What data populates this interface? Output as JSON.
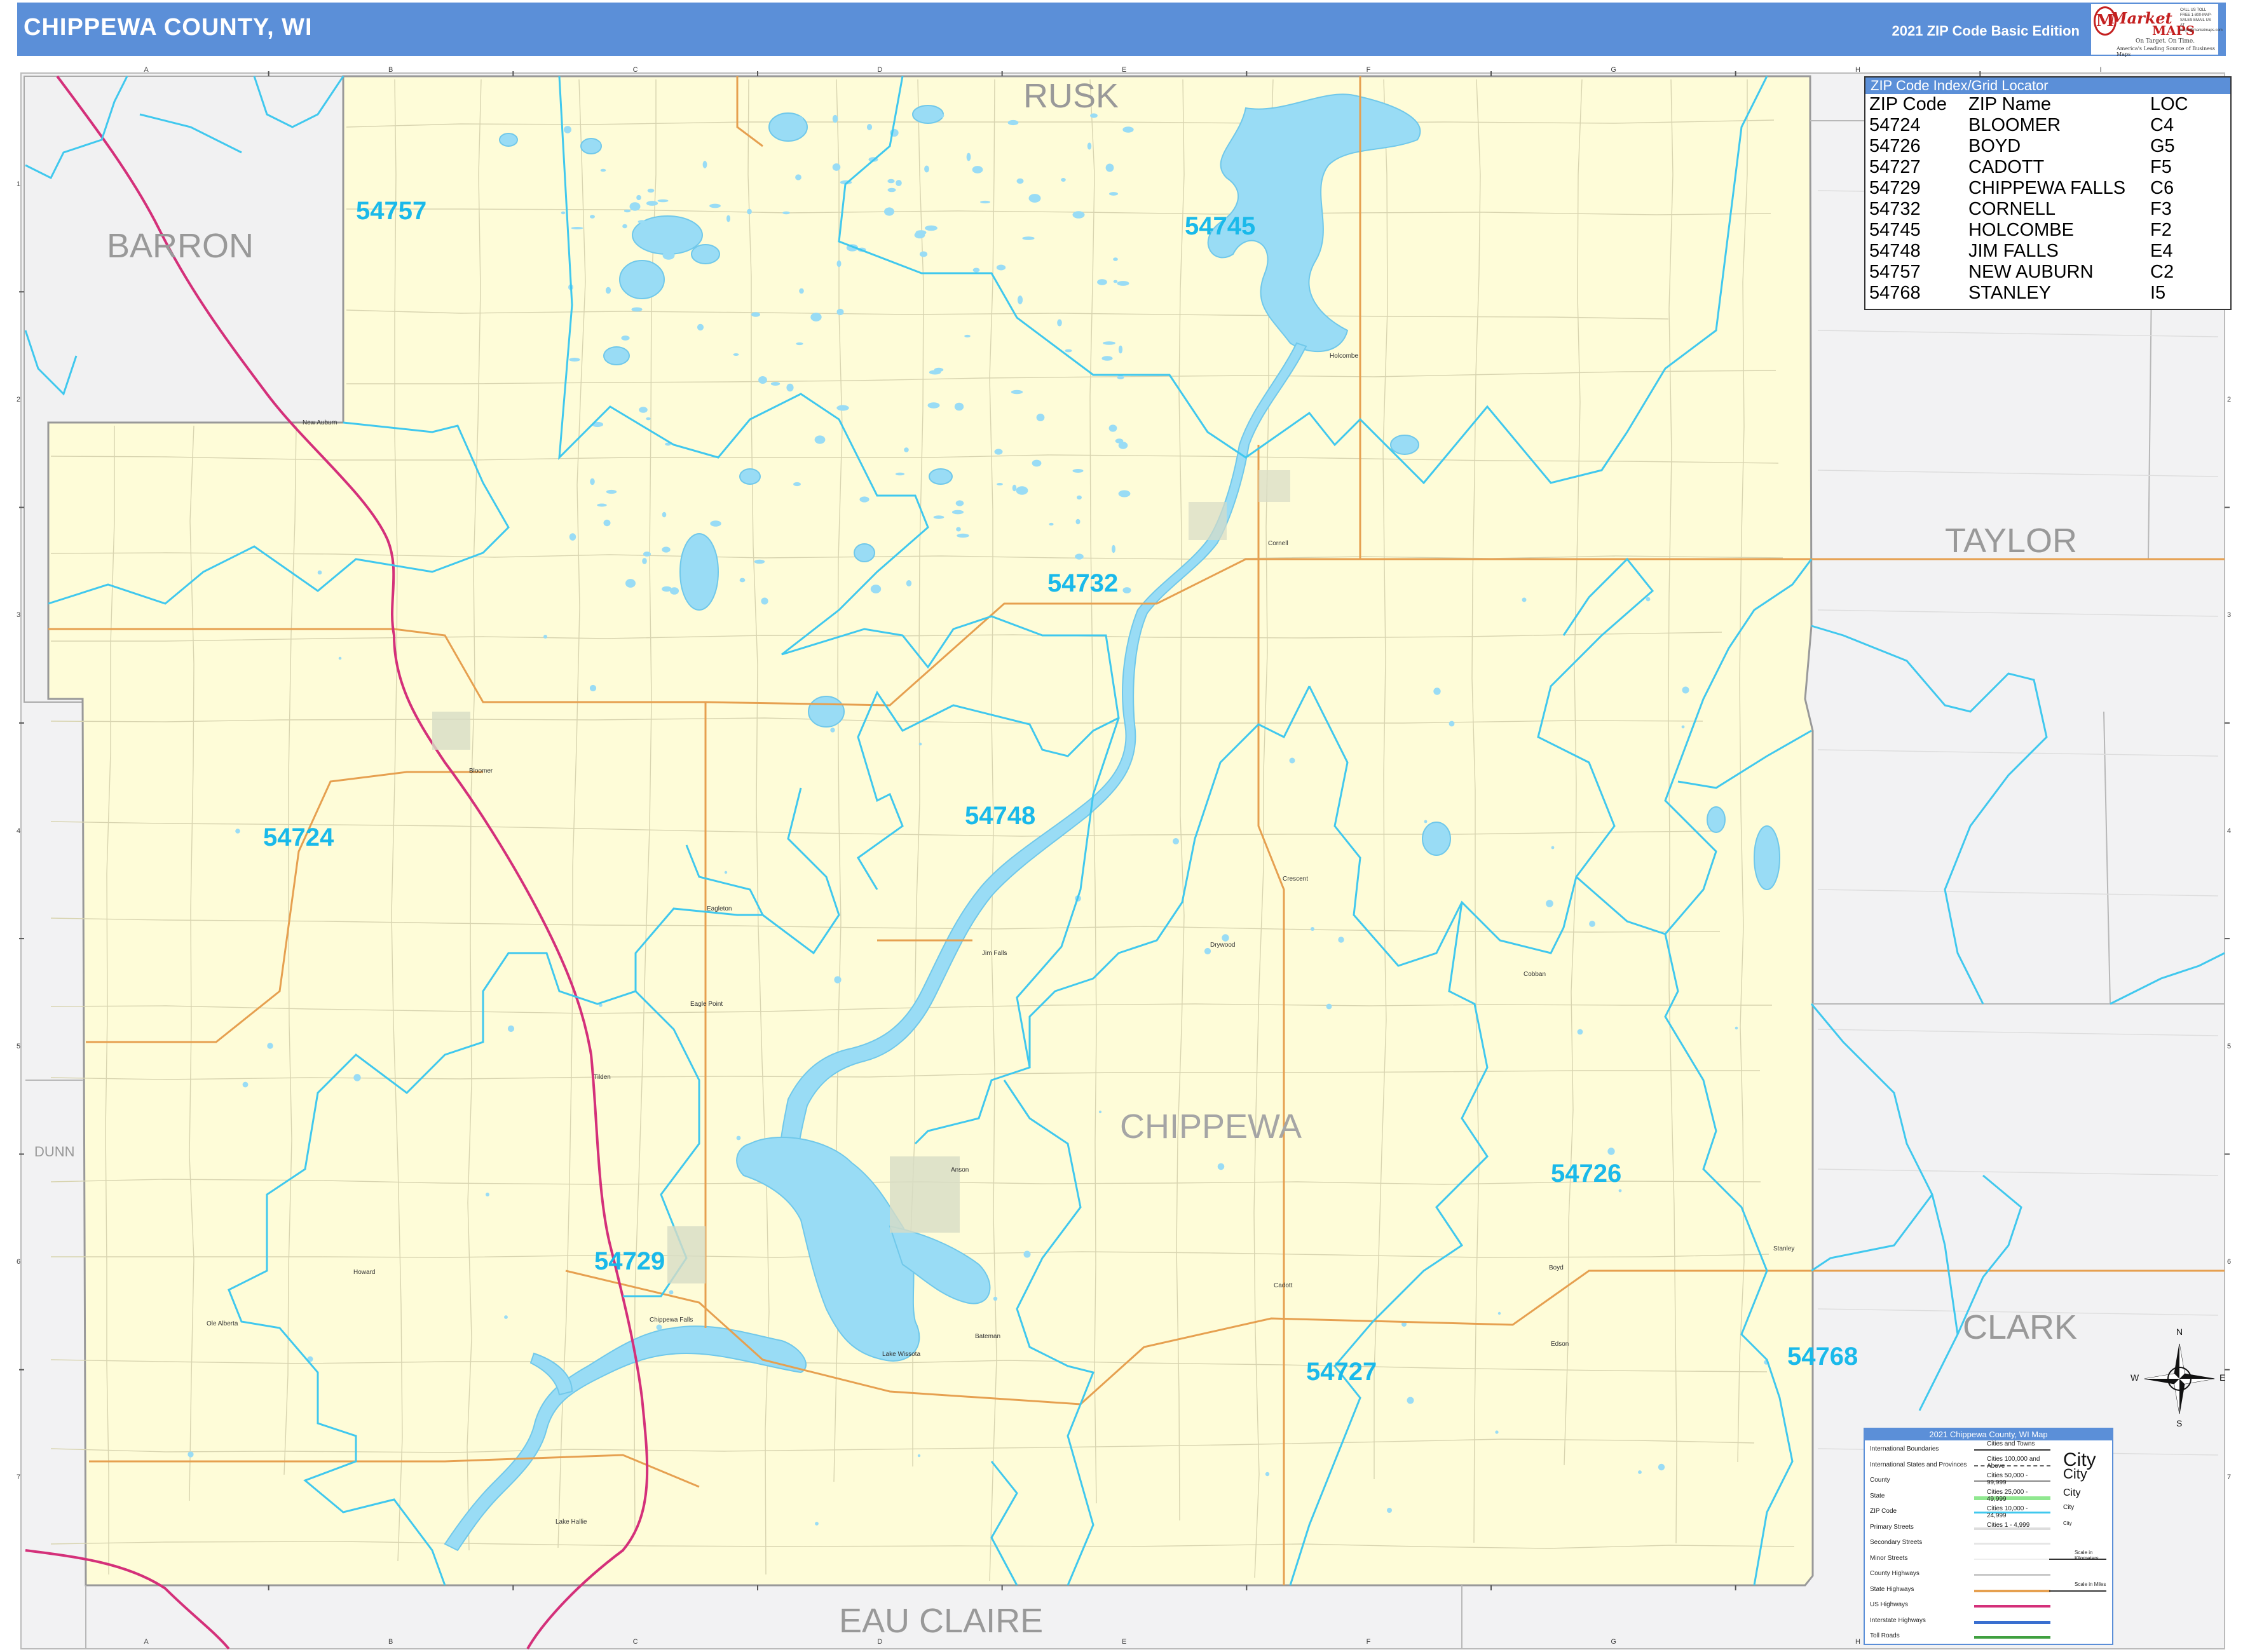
{
  "header": {
    "title": "CHIPPEWA COUNTY, WI",
    "edition": "2021 ZIP Code Basic Edition"
  },
  "logo": {
    "market": "Market",
    "maps": "MAPS",
    "tagline": "On Target. On Time.",
    "tagline2": "America's Leading Source of Business Maps",
    "call": "CALL US TOLL FREE 1-800-MAP-SALES EMAIL US AT maps@marketmaps.com"
  },
  "grid": {
    "columns": [
      "A",
      "B",
      "C",
      "D",
      "E",
      "F",
      "G",
      "H",
      "I"
    ],
    "rows": [
      "1",
      "2",
      "3",
      "4",
      "5",
      "6",
      "7"
    ]
  },
  "regions": {
    "neighbors": [
      "RUSK",
      "BARRON",
      "TAYLOR",
      "CLARK",
      "DUNN",
      "EAU CLAIRE"
    ],
    "county": "CHIPPEWA"
  },
  "zip_labels": [
    "54757",
    "54745",
    "54732",
    "54748",
    "54724",
    "54729",
    "54726",
    "54727",
    "54768"
  ],
  "places": [
    "New Auburn",
    "Holcombe",
    "Cornell",
    "Bloomer",
    "Jim Falls",
    "Eagleton",
    "Eagle Point",
    "Tilden",
    "Crescent",
    "Drywood",
    "Cobban",
    "Anson",
    "Howard",
    "Ole Alberta",
    "Chippewa Falls",
    "Lake Hallie",
    "Lake Wissota",
    "Bateman",
    "Cadott",
    "Boyd",
    "Edson",
    "Stanley"
  ],
  "zip_index": {
    "title": "ZIP Code Index/Grid Locator",
    "headers": [
      "ZIP Code",
      "ZIP Name",
      "LOC"
    ],
    "rows": [
      [
        "54724",
        "BLOOMER",
        "C4"
      ],
      [
        "54726",
        "BOYD",
        "G5"
      ],
      [
        "54727",
        "CADOTT",
        "F5"
      ],
      [
        "54729",
        "CHIPPEWA FALLS",
        "C6"
      ],
      [
        "54732",
        "CORNELL",
        "F3"
      ],
      [
        "54745",
        "HOLCOMBE",
        "F2"
      ],
      [
        "54748",
        "JIM FALLS",
        "E4"
      ],
      [
        "54757",
        "NEW AUBURN",
        "C2"
      ],
      [
        "54768",
        "STANLEY",
        "I5"
      ]
    ]
  },
  "compass": {
    "n": "N",
    "s": "S",
    "e": "E",
    "w": "W"
  },
  "legend": {
    "title": "2021 Chippewa County, WI Map",
    "lines": [
      "International Boundaries",
      "International States and Provinces",
      "County",
      "State",
      "ZIP Code",
      "Primary Streets",
      "Secondary Streets",
      "Minor Streets",
      "County Highways",
      "State Highways",
      "US Highways",
      "Interstate Highways",
      "Toll Roads"
    ],
    "cities": [
      "Cities and Towns",
      "Cities 100,000 and Above",
      "Cities 50,000 - 99,999",
      "Cities 25,000 - 49,999",
      "Cities 10,000 - 24,999",
      "Cities 1 - 4,999"
    ],
    "city_samples": [
      "City",
      "City",
      "City",
      "City",
      "City"
    ],
    "scale_km": "Scale in Kilometers",
    "scale_mi": "Scale in Miles"
  },
  "colors": {
    "header": "#5b8fd8",
    "county_fill": "#fefcd8",
    "outside_fill": "#f2f2f3",
    "water": "#99dcf5",
    "zip_boundary": "#40c8ee",
    "zip_label": "#1ab9ea",
    "state_highway": "#e6a050",
    "interstate": "#d4307a",
    "neighbor_label": "#999999"
  }
}
